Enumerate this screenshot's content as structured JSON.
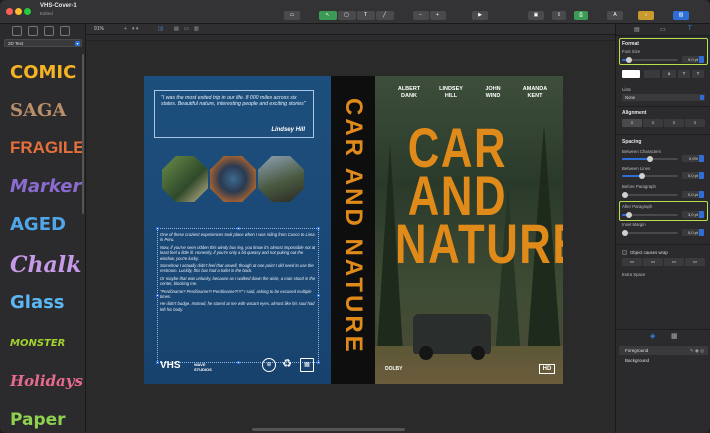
{
  "window": {
    "title": "VHS-Cover-1",
    "subtitle": "Edited"
  },
  "toolbar": {
    "view": "View",
    "editing_tools": "Editing Tools",
    "zoom": "Zoom",
    "preview_mode": "Preview Mode",
    "insert": "Insert",
    "share": "Share",
    "print": "Print",
    "fonts": "Fonts",
    "fonts_glyph": "A",
    "media_tracks": "Media Tracks",
    "inspector": "Inspector"
  },
  "sidebar": {
    "font_category": "2D Text",
    "fonts": [
      {
        "label": "COMIC",
        "color": "#f5b323"
      },
      {
        "label": "SAGA",
        "color": "#b98e6a"
      },
      {
        "label": "FRAGILE",
        "color": "#e7703a"
      },
      {
        "label": "Marker",
        "color": "#8b6bd0"
      },
      {
        "label": "AGED",
        "color": "#4fa7e8"
      },
      {
        "label": "Chalk",
        "color": "#c79ae8"
      },
      {
        "label": "Glass",
        "color": "#5bb8f5"
      },
      {
        "label": "MONSTER",
        "color": "#a3d12f"
      },
      {
        "label": "Holidays",
        "color": "#e86a8e"
      },
      {
        "label": "Paper",
        "color": "#8fd14f"
      }
    ]
  },
  "canvas": {
    "zoom": "91%",
    "cb_plus": "+",
    "cb_chevrons": "▾ ▾"
  },
  "cover": {
    "quote": "\"I was the most exited trip in our life. 8 000 miles across six states. Beautiful nature, interesting people and exciting stories\"",
    "quote_author": "Lindsey Hill",
    "body": [
      "One of these craziest experiences took place when I was riding from Cusco to Lima in Peru.",
      "Now, if you've seen ridden this windy bus leg, you know it's almost impossible not at least feel a little ill. Honestly, if you're only a bit queasy and not puking out the window, you're lucky.",
      "Somehow I actually didn't feel that unwell, though at one point I did need to use the restroom. Luckily, this bus had a toilet in the back.",
      "Or maybe that was unlucky, because as I walked down the aisle, a man stood in the center, blocking me.",
      "\"Perdóname? Perdóname?! Perdóname?!?!\" I said, asking to be excused multiple times.",
      "He didn't budge. Instead, he stared at me with vacant eyes, almost like his soul had left his body."
    ],
    "logo_vhs": "VHS",
    "logo_wave": "WAVE STUDIOS",
    "logo_circle_1": "⊕",
    "logo_circle_2": "♻",
    "spine_title": "CAR AND NATURE",
    "authors": [
      "ALBERT\nDANK",
      "LINDSEY\nHILL",
      "JOHN\nWIND",
      "AMANDA\nKENT"
    ],
    "front_title": "CAR\nAND\nNATURE",
    "logo_dolby": "DOLBY",
    "hd": "HD"
  },
  "inspector": {
    "tab_icons": [
      "▤",
      "▭",
      "T"
    ],
    "format": "Format",
    "font_size": "Font Size",
    "font_size_value": "9,0 pt",
    "font_size_level": 0.12,
    "style_buttons": [
      "",
      "a",
      "T",
      "T"
    ],
    "lists": "Lists",
    "lists_value": "None",
    "alignment": "Alignment",
    "spacing": "Spacing",
    "between_characters": "Between Characters",
    "between_characters_value": "0,0%",
    "between_characters_level": 0.5,
    "between_lines": "Between Lines",
    "between_lines_value": "0,0 pt",
    "between_lines_level": 0.35,
    "before_paragraph": "Before Paragraph",
    "before_paragraph_value": "0,0 pt",
    "before_paragraph_level": 0.05,
    "after_paragraph": "After Paragraph",
    "after_paragraph_value": "3,0 pt",
    "after_paragraph_level": 0.12,
    "inset_margin": "Inset Margin",
    "inset_margin_value": "0,0 pt",
    "inset_margin_level": 0.05,
    "object_causes_wrap": "Object causes wrap",
    "extra_space": "Extra Space",
    "layers": [
      "Foreground",
      "Background"
    ]
  },
  "colors": {
    "accent": "#2d6fd6",
    "highlight": "#b8e04a",
    "title_orange": "#e08a1a"
  }
}
